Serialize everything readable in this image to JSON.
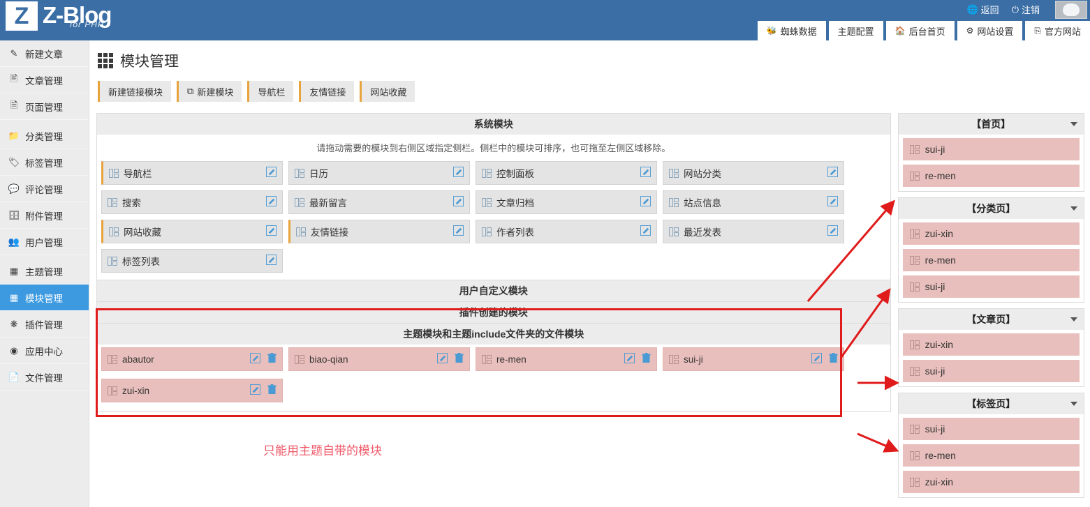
{
  "brand": {
    "logo_mark": "Z",
    "logo_text": "Z-Blog",
    "logo_sub": "for PHP"
  },
  "header": {
    "back_label": "返回",
    "logout_label": "注销",
    "tabs": [
      {
        "label": "蜘蛛数据",
        "icon": "spider-icon"
      },
      {
        "label": "主题配置",
        "icon": ""
      },
      {
        "label": "后台首页",
        "icon": "home-icon"
      },
      {
        "label": "网站设置",
        "icon": "gear-icon"
      },
      {
        "label": "官方网站",
        "icon": "z-circle-icon"
      }
    ]
  },
  "sidebar": {
    "items": [
      {
        "label": "新建文章",
        "icon": "compose-icon",
        "active": false
      },
      {
        "label": "文章管理",
        "icon": "article-icon",
        "active": false
      },
      {
        "label": "页面管理",
        "icon": "page-icon",
        "active": false
      },
      {
        "label": "分类管理",
        "icon": "folder-icon",
        "active": false
      },
      {
        "label": "标签管理",
        "icon": "tag-icon",
        "active": false
      },
      {
        "label": "评论管理",
        "icon": "comment-icon",
        "active": false
      },
      {
        "label": "附件管理",
        "icon": "attachment-icon",
        "active": false
      },
      {
        "label": "用户管理",
        "icon": "users-icon",
        "active": false
      },
      {
        "label": "主题管理",
        "icon": "theme-icon",
        "active": false
      },
      {
        "label": "模块管理",
        "icon": "module-grid-icon",
        "active": true
      },
      {
        "label": "插件管理",
        "icon": "plugin-icon",
        "active": false
      },
      {
        "label": "应用中心",
        "icon": "appstore-icon",
        "active": false
      },
      {
        "label": "文件管理",
        "icon": "file-icon",
        "active": false
      }
    ]
  },
  "page": {
    "title": "模块管理",
    "title_icon": "module-grid-icon"
  },
  "toolbar": {
    "buttons": [
      {
        "label": "新建链接模块",
        "icon": ""
      },
      {
        "label": "新建模块",
        "icon": "new-module-icon"
      },
      {
        "label": "导航栏",
        "icon": ""
      },
      {
        "label": "友情链接",
        "icon": ""
      },
      {
        "label": "网站收藏",
        "icon": ""
      }
    ]
  },
  "sections": {
    "system": {
      "title": "系统模块",
      "note": "请拖动需要的模块到右侧区域指定侧栏。侧栏中的模块可排序，也可拖至左侧区域移除。",
      "modules": [
        {
          "label": "导航栏",
          "accent": true
        },
        {
          "label": "日历",
          "accent": false
        },
        {
          "label": "控制面板",
          "accent": false
        },
        {
          "label": "网站分类",
          "accent": false
        },
        {
          "label": "搜索",
          "accent": false
        },
        {
          "label": "最新留言",
          "accent": false
        },
        {
          "label": "文章归档",
          "accent": false
        },
        {
          "label": "站点信息",
          "accent": false
        },
        {
          "label": "网站收藏",
          "accent": true
        },
        {
          "label": "友情链接",
          "accent": true
        },
        {
          "label": "作者列表",
          "accent": false
        },
        {
          "label": "最近发表",
          "accent": false
        },
        {
          "label": "标签列表",
          "accent": false
        }
      ]
    },
    "user_custom": {
      "title": "用户自定义模块",
      "modules": []
    },
    "plugin_created": {
      "title": "插件创建的模块",
      "modules": []
    },
    "theme": {
      "title": "主题模块和主题include文件夹的文件模块",
      "modules": [
        {
          "label": "abautor"
        },
        {
          "label": "biao-qian"
        },
        {
          "label": "re-men"
        },
        {
          "label": "sui-ji"
        },
        {
          "label": "zui-xin"
        }
      ]
    }
  },
  "annotation": {
    "note": "只能用主题自带的模块",
    "color": "#f05a6a"
  },
  "side_panels": [
    {
      "title": "【首页】",
      "modules": [
        "sui-ji",
        "re-men"
      ]
    },
    {
      "title": "【分类页】",
      "modules": [
        "zui-xin",
        "re-men",
        "sui-ji"
      ]
    },
    {
      "title": "【文章页】",
      "modules": [
        "zui-xin",
        "sui-ji"
      ]
    },
    {
      "title": "【标签页】",
      "modules": [
        "sui-ji",
        "re-men",
        "zui-xin"
      ]
    }
  ],
  "colors": {
    "header_blue": "#3b6ea5",
    "active_blue": "#3d9ae0",
    "accent_orange": "#e8a33d",
    "theme_pink": "#e8bfbc",
    "annotation_red": "#e01b1b"
  }
}
